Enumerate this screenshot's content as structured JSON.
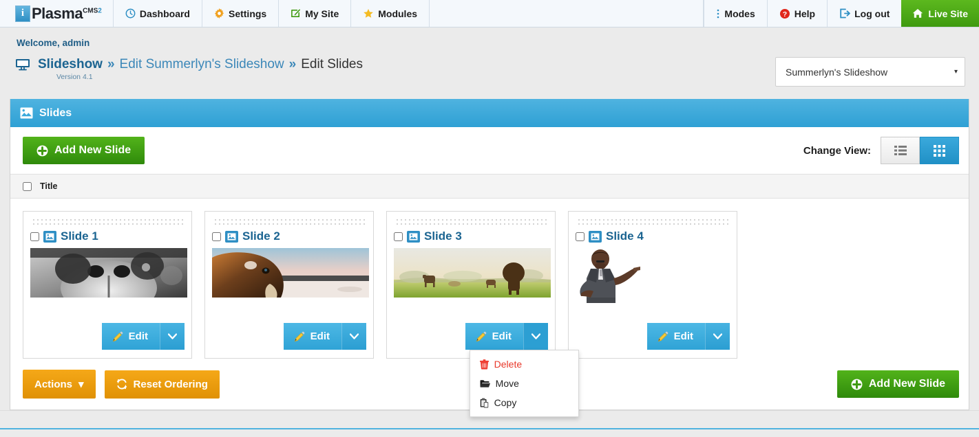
{
  "brand": {
    "mark_letter": "i",
    "word": "Plasma",
    "sup": "CMS",
    "sup_two": "2"
  },
  "topnav": {
    "left_items": [
      {
        "label": "Dashboard",
        "icon": "clock-icon"
      },
      {
        "label": "Settings",
        "icon": "gear-icon"
      },
      {
        "label": "My Site",
        "icon": "edit-square-icon"
      },
      {
        "label": "Modules",
        "icon": "star-icon"
      }
    ],
    "right_items": [
      {
        "label": "Modes",
        "icon": "vertical-dots-icon"
      },
      {
        "label": "Help",
        "icon": "help-circle-icon"
      },
      {
        "label": "Log out",
        "icon": "logout-icon"
      }
    ],
    "live_site": {
      "label": "Live Site",
      "icon": "home-icon"
    }
  },
  "header": {
    "welcome": "Welcome, admin",
    "breadcrumb": {
      "icon": "desktop-icon",
      "main": "Slideshow",
      "sep1": "»",
      "mid": "Edit Summerlyn's Slideshow",
      "sep2": "»",
      "last": "Edit Slides"
    },
    "version": "Version 4.1",
    "slideshow_select": {
      "value": "Summerlyn's Slideshow",
      "caret": "▾"
    }
  },
  "panel": {
    "title": "Slides",
    "title_icon": "image-icon",
    "add_new_slide": "Add New Slide",
    "change_view_label": "Change View:",
    "view_list_icon": "list-view-icon",
    "view_grid_icon": "grid-view-icon",
    "active_view": "grid",
    "column_header_title": "Title"
  },
  "slides": [
    {
      "title": "Slide 1",
      "thumb": "dog-nose-bw",
      "edit_label": "Edit",
      "menu_open": false,
      "thumb_size": "wide"
    },
    {
      "title": "Slide 2",
      "thumb": "horse-snow",
      "edit_label": "Edit",
      "menu_open": false,
      "thumb_size": "wide"
    },
    {
      "title": "Slide 3",
      "thumb": "cows-field",
      "edit_label": "Edit",
      "menu_open": true,
      "thumb_size": "wide"
    },
    {
      "title": "Slide 4",
      "thumb": "man-pointing",
      "edit_label": "Edit",
      "menu_open": false,
      "thumb_size": "small"
    }
  ],
  "slide_menu": [
    {
      "label": "Delete",
      "icon": "trash-icon",
      "danger": true
    },
    {
      "label": "Move",
      "icon": "folder-open-icon",
      "danger": false
    },
    {
      "label": "Copy",
      "icon": "paste-icon",
      "danger": false
    }
  ],
  "bottom": {
    "actions_label": "Actions",
    "actions_caret": "▾",
    "reset_ordering_label": "Reset Ordering",
    "reset_icon": "refresh-icon",
    "add_new_slide_label": "Add New Slide",
    "add_icon": "plus-circle-icon"
  },
  "colors": {
    "brand_blue": "#2e8fc4",
    "panel_header_blue": "#3aa9dc",
    "green": "#3f9a10",
    "orange": "#e09105",
    "danger_red": "#e8382a",
    "link_blue": "#1b6491"
  }
}
